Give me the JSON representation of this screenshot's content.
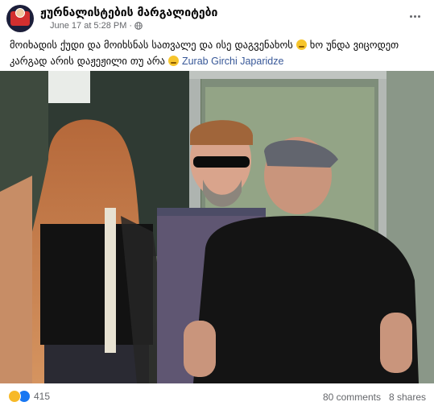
{
  "post": {
    "page_name": "ჟურნალისტების მარგალიტები",
    "timestamp": "June 17 at 5:28 PM",
    "privacy_dot": "·",
    "text_part1": "მოიხადის ქუდი და მოიხსნას სათვალე და ისე დაგვენახოს",
    "text_part2": "ხო უნდა ვიცოდეთ კარგად არის დაჟეჟილი თუ არა",
    "mention": "Zurab Girchi Japaridze"
  },
  "footer": {
    "reaction_count": "415",
    "comments": "80 comments",
    "shares": "8 shares"
  },
  "colors": {
    "text_primary": "#050505",
    "text_secondary": "#65676b",
    "link": "#385898",
    "like_blue": "#1877f2",
    "haha_yellow": "#f7b928"
  },
  "icons": {
    "globe": "globe-icon",
    "more": "more-options-icon",
    "haha": "haha-reaction-icon",
    "like": "like-reaction-icon"
  }
}
